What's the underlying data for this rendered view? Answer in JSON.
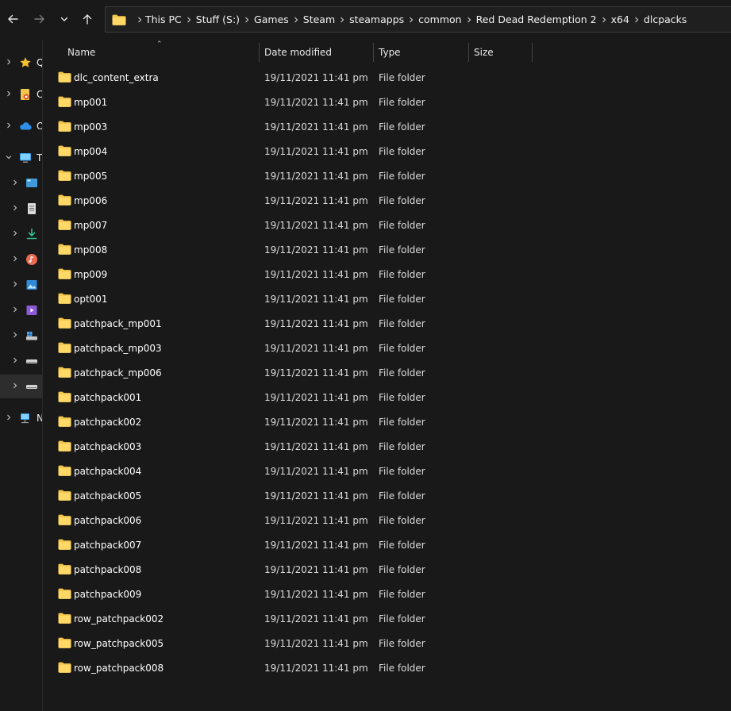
{
  "toolbar": {
    "back_icon": "arrow-left-icon",
    "forward_icon": "arrow-right-icon",
    "recent_icon": "chevron-down-icon",
    "up_icon": "arrow-up-icon"
  },
  "address": {
    "crumbs": [
      "This PC",
      "Stuff (S:)",
      "Games",
      "Steam",
      "steamapps",
      "common",
      "Red Dead Redemption 2",
      "x64",
      "dlcpacks"
    ]
  },
  "navpane": {
    "items": [
      {
        "letter": "Q",
        "icon": "star-icon"
      },
      {
        "letter": "C",
        "icon": "user-folder-icon"
      },
      {
        "letter": "O",
        "icon": "cloud-icon"
      },
      {
        "letter": "T",
        "icon": "this-pc-icon"
      },
      {
        "letter": "",
        "icon": "desktop-icon"
      },
      {
        "letter": "",
        "icon": "documents-icon"
      },
      {
        "letter": "",
        "icon": "downloads-icon"
      },
      {
        "letter": "",
        "icon": "music-icon"
      },
      {
        "letter": "",
        "icon": "pictures-icon"
      },
      {
        "letter": "",
        "icon": "videos-icon"
      },
      {
        "letter": "",
        "icon": "windows-drive-icon"
      },
      {
        "letter": "",
        "icon": "drive-icon"
      },
      {
        "letter": "",
        "icon": "drive-icon"
      },
      {
        "letter": "N",
        "icon": "network-icon"
      }
    ]
  },
  "columns": {
    "name": "Name",
    "date": "Date modified",
    "type": "Type",
    "size": "Size"
  },
  "colors": {
    "folder": "#f5c84c",
    "background": "#191919"
  },
  "files": [
    {
      "name": "dlc_content_extra",
      "date": "19/11/2021 11:41 pm",
      "type": "File folder"
    },
    {
      "name": "mp001",
      "date": "19/11/2021 11:41 pm",
      "type": "File folder"
    },
    {
      "name": "mp003",
      "date": "19/11/2021 11:41 pm",
      "type": "File folder"
    },
    {
      "name": "mp004",
      "date": "19/11/2021 11:41 pm",
      "type": "File folder"
    },
    {
      "name": "mp005",
      "date": "19/11/2021 11:41 pm",
      "type": "File folder"
    },
    {
      "name": "mp006",
      "date": "19/11/2021 11:41 pm",
      "type": "File folder"
    },
    {
      "name": "mp007",
      "date": "19/11/2021 11:41 pm",
      "type": "File folder"
    },
    {
      "name": "mp008",
      "date": "19/11/2021 11:41 pm",
      "type": "File folder"
    },
    {
      "name": "mp009",
      "date": "19/11/2021 11:41 pm",
      "type": "File folder"
    },
    {
      "name": "opt001",
      "date": "19/11/2021 11:41 pm",
      "type": "File folder"
    },
    {
      "name": "patchpack_mp001",
      "date": "19/11/2021 11:41 pm",
      "type": "File folder"
    },
    {
      "name": "patchpack_mp003",
      "date": "19/11/2021 11:41 pm",
      "type": "File folder"
    },
    {
      "name": "patchpack_mp006",
      "date": "19/11/2021 11:41 pm",
      "type": "File folder"
    },
    {
      "name": "patchpack001",
      "date": "19/11/2021 11:41 pm",
      "type": "File folder"
    },
    {
      "name": "patchpack002",
      "date": "19/11/2021 11:41 pm",
      "type": "File folder"
    },
    {
      "name": "patchpack003",
      "date": "19/11/2021 11:41 pm",
      "type": "File folder"
    },
    {
      "name": "patchpack004",
      "date": "19/11/2021 11:41 pm",
      "type": "File folder"
    },
    {
      "name": "patchpack005",
      "date": "19/11/2021 11:41 pm",
      "type": "File folder"
    },
    {
      "name": "patchpack006",
      "date": "19/11/2021 11:41 pm",
      "type": "File folder"
    },
    {
      "name": "patchpack007",
      "date": "19/11/2021 11:41 pm",
      "type": "File folder"
    },
    {
      "name": "patchpack008",
      "date": "19/11/2021 11:41 pm",
      "type": "File folder"
    },
    {
      "name": "patchpack009",
      "date": "19/11/2021 11:41 pm",
      "type": "File folder"
    },
    {
      "name": "row_patchpack002",
      "date": "19/11/2021 11:41 pm",
      "type": "File folder"
    },
    {
      "name": "row_patchpack005",
      "date": "19/11/2021 11:41 pm",
      "type": "File folder"
    },
    {
      "name": "row_patchpack008",
      "date": "19/11/2021 11:41 pm",
      "type": "File folder"
    }
  ]
}
